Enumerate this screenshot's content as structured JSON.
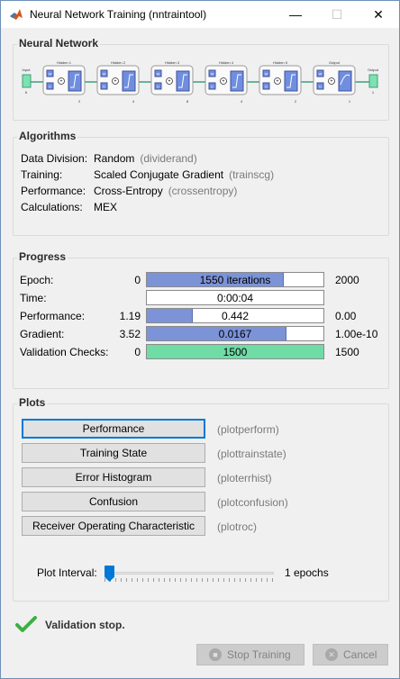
{
  "window": {
    "title": "Neural Network Training (nntraintool)"
  },
  "sections": {
    "network": "Neural Network",
    "algorithms": "Algorithms",
    "progress": "Progress",
    "plots": "Plots"
  },
  "network": {
    "input": {
      "label": "Input",
      "size": "6"
    },
    "layers": [
      {
        "label": "Hidden 1",
        "size": "2"
      },
      {
        "label": "Hidden 2",
        "size": "4"
      },
      {
        "label": "Hidden 3",
        "size": "8"
      },
      {
        "label": "Hidden 4",
        "size": "4"
      },
      {
        "label": "Hidden 5",
        "size": "2"
      },
      {
        "label": "Output",
        "size": "1"
      }
    ],
    "output": {
      "label": "Output",
      "size": "1"
    },
    "weight_letter": "W",
    "bias_letter": "b"
  },
  "algorithms": [
    {
      "key": "Data Division:",
      "value": "Random",
      "fn": "(dividerand)"
    },
    {
      "key": "Training:",
      "value": "Scaled Conjugate Gradient",
      "fn": "(trainscg)"
    },
    {
      "key": "Performance:",
      "value": "Cross-Entropy",
      "fn": "(crossentropy)"
    },
    {
      "key": "Calculations:",
      "value": "MEX",
      "fn": ""
    }
  ],
  "progress": [
    {
      "label": "Epoch:",
      "start": "0",
      "current": "1550 iterations",
      "end": "2000",
      "fill": 0.775,
      "color": "blue"
    },
    {
      "label": "Time:",
      "start": "",
      "current": "0:00:04",
      "end": "",
      "fill": 0,
      "color": "blue"
    },
    {
      "label": "Performance:",
      "start": "1.19",
      "current": "0.442",
      "end": "0.00",
      "fill": 0.26,
      "color": "blue"
    },
    {
      "label": "Gradient:",
      "start": "3.52",
      "current": "0.0167",
      "end": "1.00e-10",
      "fill": 0.79,
      "color": "blue"
    },
    {
      "label": "Validation Checks:",
      "start": "0",
      "current": "1500",
      "end": "1500",
      "fill": 1.0,
      "color": "green"
    }
  ],
  "plots": [
    {
      "label": "Performance",
      "fn": "(plotperform)"
    },
    {
      "label": "Training State",
      "fn": "(plottrainstate)"
    },
    {
      "label": "Error Histogram",
      "fn": "(ploterrhist)"
    },
    {
      "label": "Confusion",
      "fn": "(plotconfusion)"
    },
    {
      "label": "Receiver Operating Characteristic",
      "fn": "(plotroc)"
    }
  ],
  "plot_interval": {
    "label": "Plot Interval:",
    "value": "1 epochs",
    "level": 0.0
  },
  "status": {
    "text": "Validation stop."
  },
  "buttons": {
    "stop": "Stop Training",
    "cancel": "Cancel"
  },
  "colors": {
    "accent": "#0078d7",
    "bar_blue": "#7c93d8",
    "bar_green": "#6fdca6",
    "check_green": "#3cb043"
  }
}
